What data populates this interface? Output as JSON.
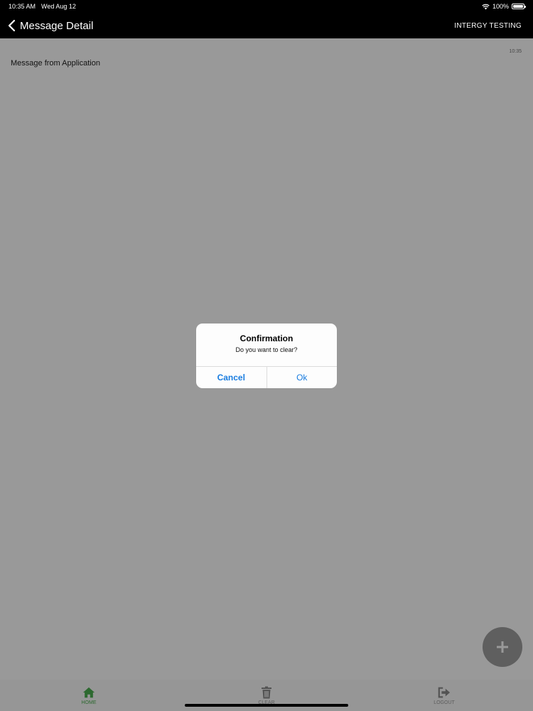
{
  "status_bar": {
    "time": "10:35 AM",
    "date": "Wed Aug 12",
    "battery": "100%",
    "battery_level": 1.0
  },
  "nav": {
    "title": "Message Detail",
    "right_label": "INTERGY TESTING"
  },
  "message": {
    "time": "10:35",
    "text": "Message from Application"
  },
  "tabs": [
    {
      "label": "HOME",
      "icon": "home-icon"
    },
    {
      "label": "CLEAR",
      "icon": "trash-icon"
    },
    {
      "label": "LOGOUT",
      "icon": "logout-icon"
    }
  ],
  "fab": {
    "icon": "plus-icon"
  },
  "dialog": {
    "title": "Confirmation",
    "message": "Do you want to clear?",
    "cancel_label": "Cancel",
    "ok_label": "Ok"
  },
  "colors": {
    "active_tab": "#4caf50",
    "dialog_button": "#1a7de0"
  }
}
